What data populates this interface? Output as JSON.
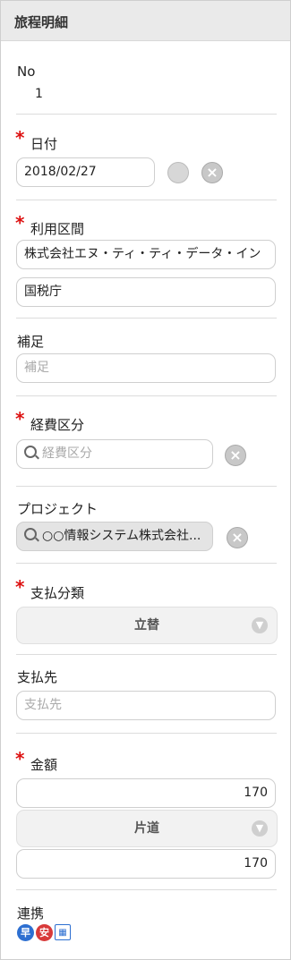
{
  "header": {
    "title": "旅程明細"
  },
  "no": {
    "label": "No",
    "value": "1"
  },
  "date": {
    "required_mark": "*",
    "label": "日付",
    "value": "2018/02/27"
  },
  "section": {
    "required_mark": "*",
    "label": "利用区間",
    "from": "株式会社エヌ・ティ・ティ・データ・イン",
    "to": "国税庁"
  },
  "supplement": {
    "label": "補足",
    "placeholder": "補足"
  },
  "expense_category": {
    "required_mark": "*",
    "label": "経費区分",
    "placeholder": "経費区分"
  },
  "project": {
    "label": "プロジェクト",
    "value": "○○情報システム株式会社..."
  },
  "payment_category": {
    "required_mark": "*",
    "label": "支払分類",
    "value": "立替"
  },
  "payee": {
    "label": "支払先",
    "placeholder": "支払先"
  },
  "amount": {
    "required_mark": "*",
    "label": "金額",
    "value1": "170",
    "trip_type": "片道",
    "value2": "170"
  },
  "linkage": {
    "label": "連携",
    "icons": [
      "haya",
      "yasu",
      "calendar"
    ],
    "haya_label": "早",
    "yasu_label": "安"
  }
}
